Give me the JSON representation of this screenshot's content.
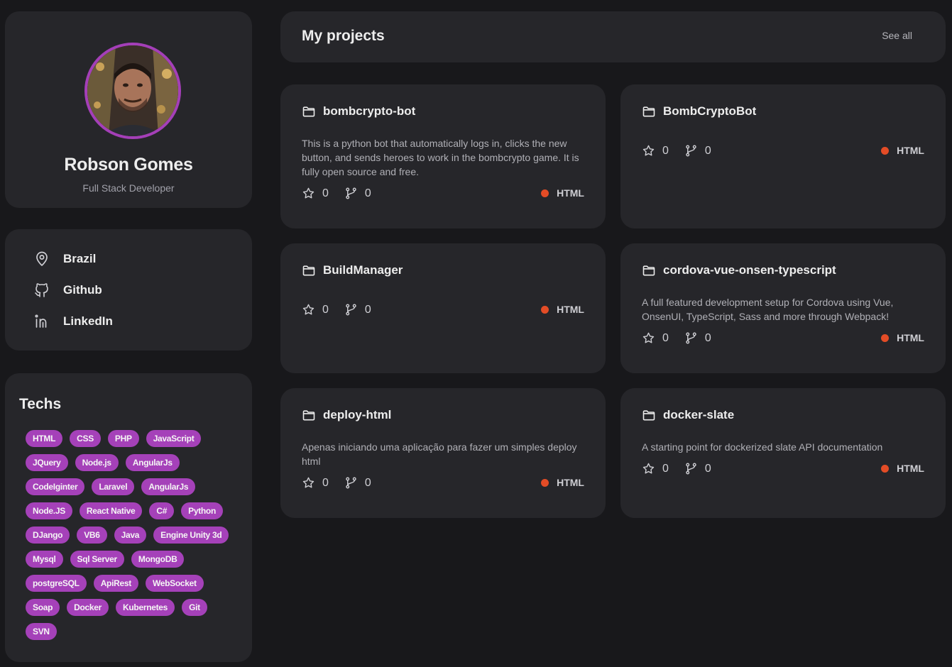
{
  "profile": {
    "name": "Robson Gomes",
    "role": "Full Stack Developer"
  },
  "links": [
    {
      "label": "Brazil",
      "icon": "map-pin-icon"
    },
    {
      "label": "Github",
      "icon": "github-icon"
    },
    {
      "label": "LinkedIn",
      "icon": "linkedin-icon"
    }
  ],
  "techs": {
    "title": "Techs",
    "items": [
      "HTML",
      "CSS",
      "PHP",
      "JavaScript",
      "JQuery",
      "Node.js",
      "AngularJs",
      "CodeIginter",
      "Laravel",
      "AngularJs",
      "Node.JS",
      "React Native",
      "C#",
      "Python",
      "DJango",
      "VB6",
      "Java",
      "Engine Unity 3d",
      "Mysql",
      "Sql Server",
      "MongoDB",
      "postgreSQL",
      "ApiRest",
      "WebSocket",
      "Soap",
      "Docker",
      "Kubernetes",
      "Git",
      "SVN"
    ]
  },
  "projects": {
    "title": "My projects",
    "see_all": "See all",
    "repos": [
      {
        "name": "bombcrypto-bot",
        "description": "This is a python bot that automatically logs in, clicks the new button, and sends heroes to work in the bombcrypto game. It is fully open source and free.",
        "stars": "0",
        "forks": "0",
        "language": "HTML"
      },
      {
        "name": "BombCryptoBot",
        "description": "",
        "stars": "0",
        "forks": "0",
        "language": "HTML"
      },
      {
        "name": "BuildManager",
        "description": "",
        "stars": "0",
        "forks": "0",
        "language": "HTML"
      },
      {
        "name": "cordova-vue-onsen-typescript",
        "description": "A full featured development setup for Cordova using Vue, OnsenUI, TypeScript, Sass and more through Webpack!",
        "stars": "0",
        "forks": "0",
        "language": "HTML"
      },
      {
        "name": "deploy-html",
        "description": "Apenas iniciando uma aplicação para fazer um simples deploy html",
        "stars": "0",
        "forks": "0",
        "language": "HTML"
      },
      {
        "name": "docker-slate",
        "description": "A starting point for dockerized slate API documentation",
        "stars": "0",
        "forks": "0",
        "language": "HTML"
      }
    ]
  },
  "colors": {
    "accent": "#a541b9",
    "html_language": "#e34c26",
    "background": "#18181b",
    "card": "#26262a"
  }
}
